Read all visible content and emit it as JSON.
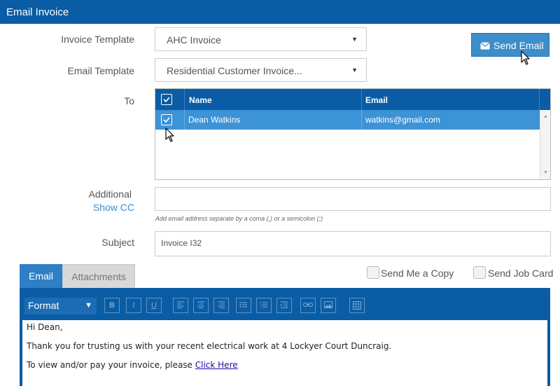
{
  "window": {
    "title": "Email Invoice"
  },
  "form": {
    "invoice_template_label": "Invoice Template",
    "invoice_template_value": "AHC Invoice",
    "email_template_label": "Email Template",
    "email_template_value": "Residential Customer Invoice...",
    "to_label": "To",
    "additional_label": "Additional",
    "show_cc_label": "Show CC",
    "additional_hint": "Add email address separate by a coma (,) or a semicolon (;)",
    "subject_label": "Subject",
    "subject_value": "Invoice I32"
  },
  "send_button": {
    "label": "Send Email",
    "icon": "envelope-icon"
  },
  "recipients": {
    "columns": {
      "name": "Name",
      "email": "Email"
    },
    "rows": [
      {
        "name": "Dean Watkins",
        "email": "watkins@gmail.com",
        "checked": true
      }
    ]
  },
  "tabs": {
    "email": "Email",
    "attachments": "Attachments"
  },
  "options": {
    "send_me_copy": "Send Me a Copy",
    "send_job_card": "Send Job Card"
  },
  "editor": {
    "format_label": "Format",
    "toolbar": {
      "bold": "B",
      "italic": "I",
      "underline": "U"
    },
    "body": {
      "line1": "Hi Dean,",
      "line2": "Thank you for trusting us with your recent electrical work at 4 Lockyer Court Duncraig.",
      "line3_prefix": "To view and/or pay your invoice, please ",
      "line3_link": "Click Here"
    }
  },
  "colors": {
    "header_blue": "#0a5da5",
    "button_blue": "#3c8dca",
    "selected_row": "#3c93d6"
  }
}
